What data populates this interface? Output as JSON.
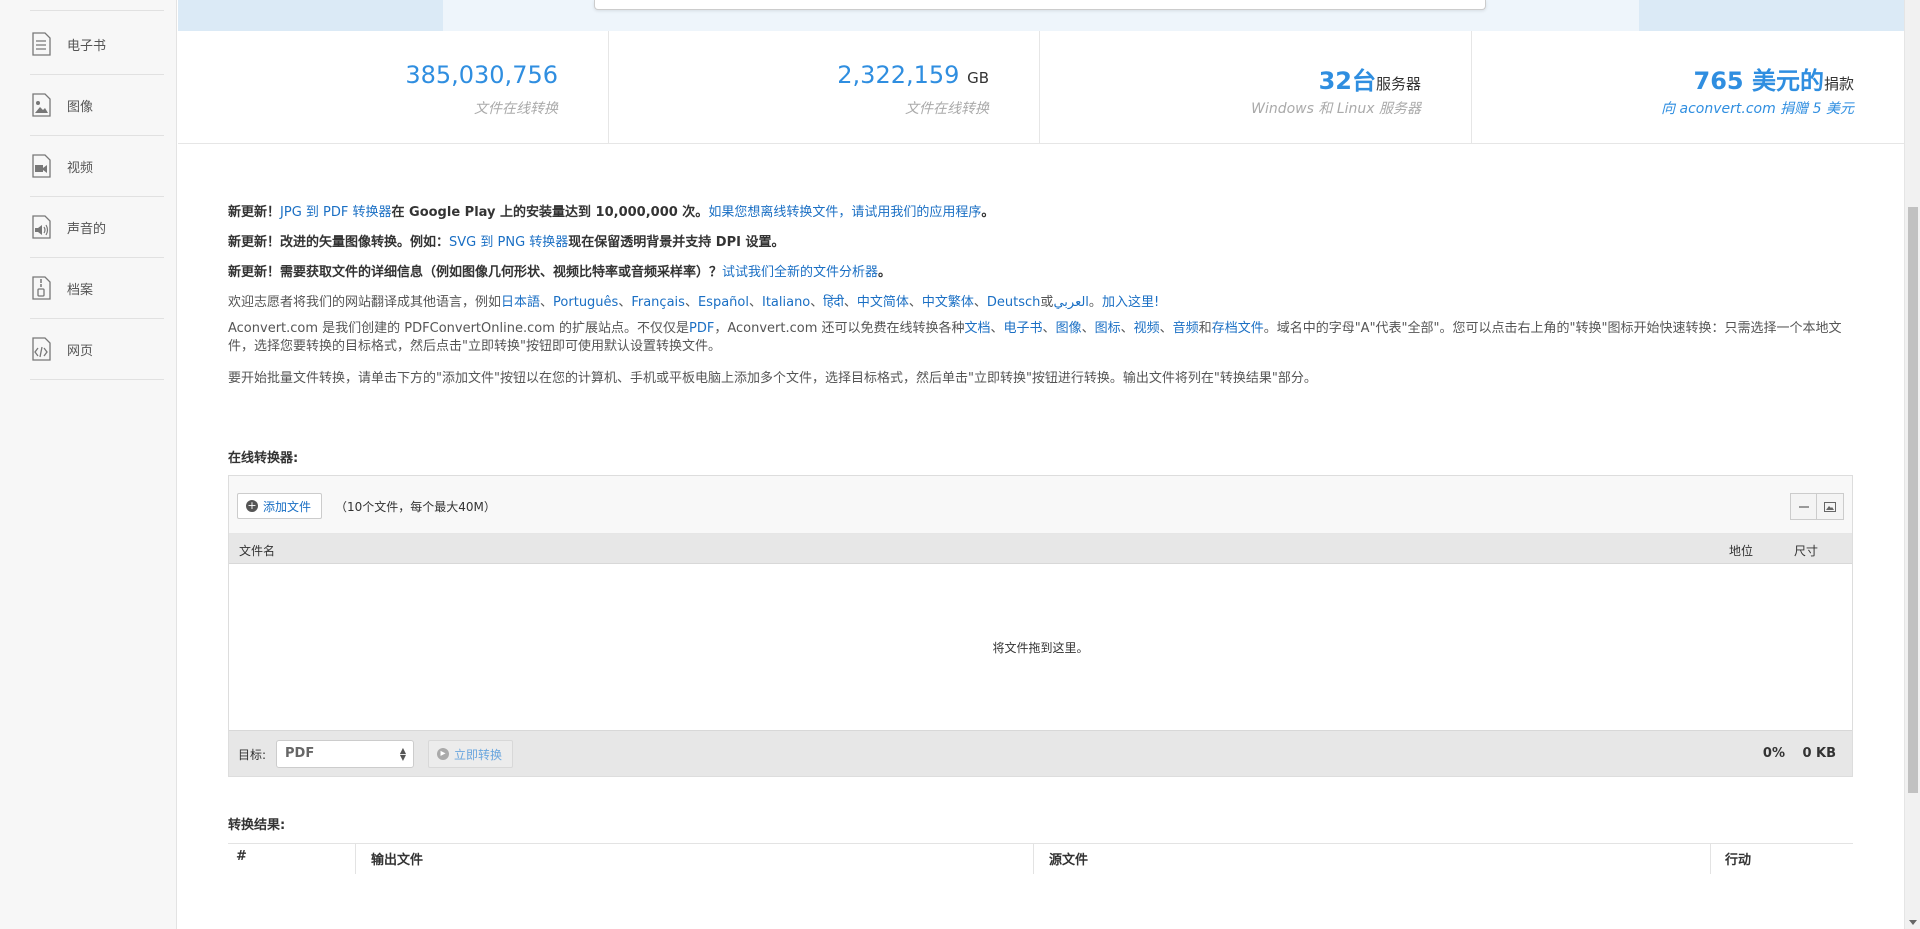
{
  "sidebar": {
    "items": [
      {
        "label": "电子书",
        "icon": "ebook-icon"
      },
      {
        "label": "图像",
        "icon": "image-icon"
      },
      {
        "label": "视频",
        "icon": "video-icon"
      },
      {
        "label": "声音的",
        "icon": "audio-icon"
      },
      {
        "label": "档案",
        "icon": "archive-icon"
      },
      {
        "label": "网页",
        "icon": "webpage-icon"
      }
    ]
  },
  "stats": [
    {
      "value": "385,030,756",
      "unit": "",
      "sub": "文件在线转换"
    },
    {
      "value": "2,322,159",
      "unit": "GB",
      "sub": "文件在线转换"
    },
    {
      "value": "32台",
      "unit": "服务器",
      "sub": "Windows 和 Linux 服务器"
    },
    {
      "value": "765 美元的",
      "unit": "捐款",
      "sub": "向 aconvert.com 捐赠 5 美元"
    }
  ],
  "news": {
    "line1": {
      "prefix": "新更新！",
      "link1": "JPG 到 PDF 转换器",
      "mid": "在 Google Play 上的安装量达到 10,000,000 次。",
      "link2": "如果您想离线转换文件，请试用我们的应用程序",
      "end": "。"
    },
    "line2": {
      "prefix": "新更新！改进的矢量图像转换。例如：",
      "link": "SVG 到 PNG 转换器",
      "end": "现在保留透明背景并支持 DPI 设置。"
    },
    "line3": {
      "prefix": "新更新！需要获取文件的详细信息（例如图像几何形状、视频比特率或音频采样率）？",
      "link": "试试我们全新的文件分析器",
      "end": "。"
    },
    "line4": {
      "prefix": "欢迎志愿者将我们的网站翻译成其他语言，例如",
      "langs": [
        "日本語",
        "Português",
        "Français",
        "Español",
        "Italiano",
        "हिंदी",
        "中文简体",
        "中文繁体",
        "Deutsch"
      ],
      "or": "或",
      "last_lang": "العربي",
      "join": "加入这里!"
    },
    "para1": {
      "a": "Aconvert.com 是我们创建的 PDFConvertOnline.com 的扩展站点。不仅仅是",
      "pdf": "PDF",
      "b": "，Aconvert.com 还可以免费在线转换各种",
      "types": [
        "文档",
        "电子书",
        "图像",
        "图标",
        "视频",
        "音频"
      ],
      "and": "和",
      "archive": "存档文件",
      "c": "。域名中的字母\"A\"代表\"全部\"。您可以点击右上角的\"转换\"图标开始快速转换：只需选择一个本地文件，选择您要转换的目标格式，然后点击\"立即转换\"按钮即可使用默认设置转换文件。"
    },
    "para2": "要开始批量文件转换，请单击下方的\"添加文件\"按钮以在您的计算机、手机或平板电脑上添加多个文件，选择目标格式，然后单击\"立即转换\"按钮进行转换。输出文件将列在\"转换结果\"部分。"
  },
  "converter": {
    "title": "在线转换器:",
    "add_label": "添加文件",
    "add_note": "（10个文件，每个最大40M）",
    "col_name": "文件名",
    "col_pos": "地位",
    "col_size": "尺寸",
    "drop_text": "将文件拖到这里。",
    "target_label": "目标:",
    "target_value": "PDF",
    "convert_label": "立即转换",
    "progress": "0%",
    "total_size": "0 KB"
  },
  "results": {
    "title": "转换结果:",
    "col_num": "#",
    "col_output": "输出文件",
    "col_source": "源文件",
    "col_action": "行动"
  }
}
